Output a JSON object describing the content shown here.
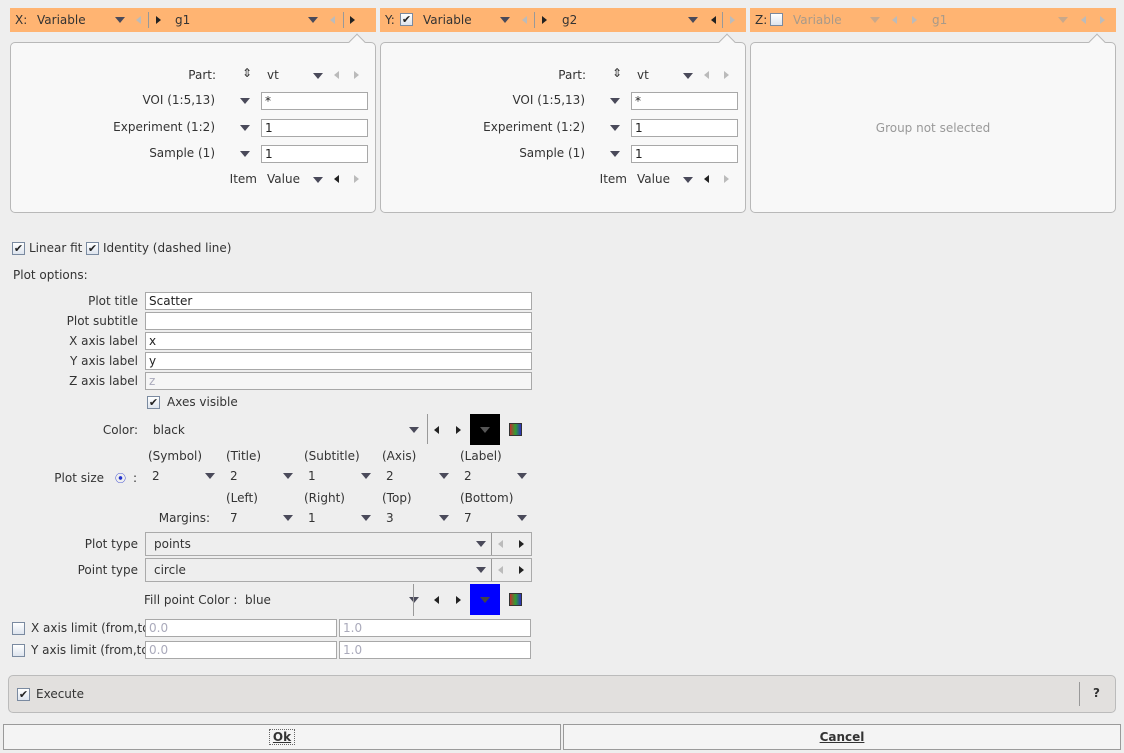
{
  "groups": [
    {
      "axis": "X:",
      "source": "Variable",
      "group": "g1",
      "checked": null
    },
    {
      "axis": "Y:",
      "source": "Variable",
      "group": "g2",
      "checked": true
    },
    {
      "axis": "Z:",
      "source": "Variable",
      "group": "g1",
      "checked": false
    }
  ],
  "panel": {
    "part_label": "Part:",
    "part_value": "vt",
    "voi_label": "VOI (1:5,13)",
    "voi_value": "*",
    "exp_label": "Experiment (1:2)",
    "exp_value": "1",
    "sample_label": "Sample (1)",
    "sample_value": "1",
    "item_label": "Item",
    "item_value": "Value",
    "z_message": "Group not selected"
  },
  "options": {
    "linear_fit": "Linear fit",
    "identity": "Identity (dashed line)",
    "plot_options": "Plot options:",
    "plot_title_label": "Plot title",
    "plot_title": "Scatter",
    "plot_subtitle_label": "Plot subtitle",
    "plot_subtitle": "",
    "x_label_label": "X axis label",
    "x_label": "x",
    "y_label_label": "Y axis label",
    "y_label": "y",
    "z_label_label": "Z axis label",
    "z_label": "z",
    "axes_visible": "Axes visible",
    "color_label": "Color:",
    "color": "black",
    "plot_size_label": "Plot size",
    "size_headers": [
      "(Symbol)",
      "(Title)",
      "(Subtitle)",
      "(Axis)",
      "(Label)"
    ],
    "size_values": [
      "2",
      "2",
      "1",
      "2",
      "2"
    ],
    "margins_label": "Margins:",
    "margin_headers": [
      "(Left)",
      "(Right)",
      "(Top)",
      "(Bottom)"
    ],
    "margin_values": [
      "7",
      "1",
      "3",
      "7"
    ],
    "plot_type_label": "Plot type",
    "plot_type": "points",
    "point_type_label": "Point type",
    "point_type": "circle",
    "fill_label": "Fill point Color :",
    "fill_color": "blue",
    "x_limit_label": "X axis limit (from,to)",
    "x_from": "0.0",
    "x_to": "1.0",
    "y_limit_label": "Y axis limit (from,to)",
    "y_from": "0.0",
    "y_to": "1.0"
  },
  "execute": "Execute",
  "help": "?",
  "ok": "Ok",
  "cancel": "Cancel",
  "colors": {
    "header": "#ffb472",
    "color_swatch": "#000000",
    "fill_swatch": "#0000ff"
  }
}
